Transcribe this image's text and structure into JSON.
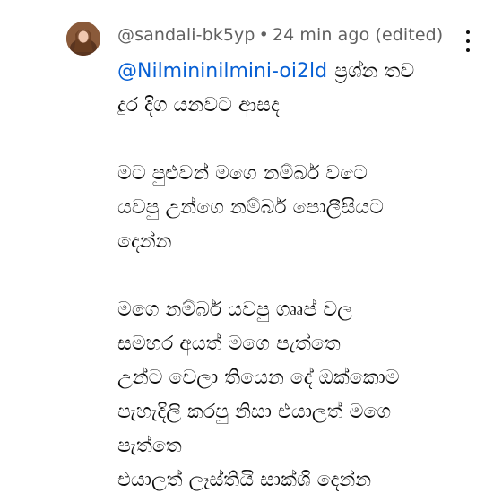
{
  "comment": {
    "author": "@sandali-bk5yp",
    "timestamp": "24 min ago (edited)",
    "menu_icon": "more-vert-icon",
    "mention": "@Nilmininilmini-oi2ld",
    "line1": "ප්‍රශ්න තව",
    "line2": "දුර දිග යනවට ආසද",
    "line3": "මට පුළුවන් මගෙ නම්බර් වටෙ",
    "line4": "යවපු උන්ගෙ නම්බර්  පොලීසියට",
    "line5": "දෙන්න",
    "line6": "මගෙ නම්බර් යවපු ග්‍රූප් වල",
    "line7": "සමහර අයත් මගෙ පැත්තෙ",
    "line8": "උන්ට වෙලා තියෙන දේ ඔක්කොම",
    "line9": "පැහැදිලි කරපු නිසා එයාලත් මගෙ",
    "line10": "පැත්තෙ",
    "line11": "එයාලත් ලෑස්තියි සාක්ශි දෙන්න"
  }
}
